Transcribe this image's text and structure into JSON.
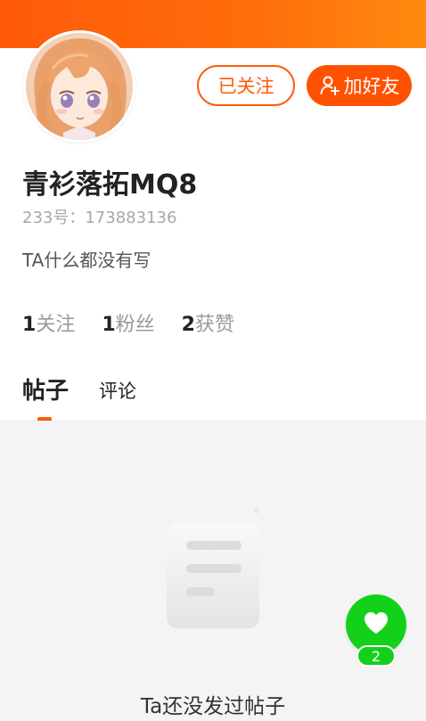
{
  "header": {
    "gradient_from": "#ff5a0a",
    "gradient_to": "#ff8a10"
  },
  "profile": {
    "username": "青衫落拓MQ8",
    "id_line": "233号：173883136",
    "bio": "TA什么都没有写",
    "avatar_icon": "anime-girl-avatar"
  },
  "actions": {
    "followed_label": "已关注",
    "add_friend_label": "加好友",
    "add_friend_icon": "add-user-icon",
    "accent_color": "#ff5a0a"
  },
  "stats": [
    {
      "num": "1",
      "label": "关注"
    },
    {
      "num": "1",
      "label": "粉丝"
    },
    {
      "num": "2",
      "label": "获赞"
    }
  ],
  "tabs": [
    {
      "label": "帖子",
      "active": true
    },
    {
      "label": "评论",
      "active": false
    }
  ],
  "empty_state": {
    "text": "Ta还没发过帖子",
    "icon": "document-icon"
  },
  "like_fab": {
    "icon": "heart-icon",
    "count": "2",
    "color": "#13d11b"
  }
}
